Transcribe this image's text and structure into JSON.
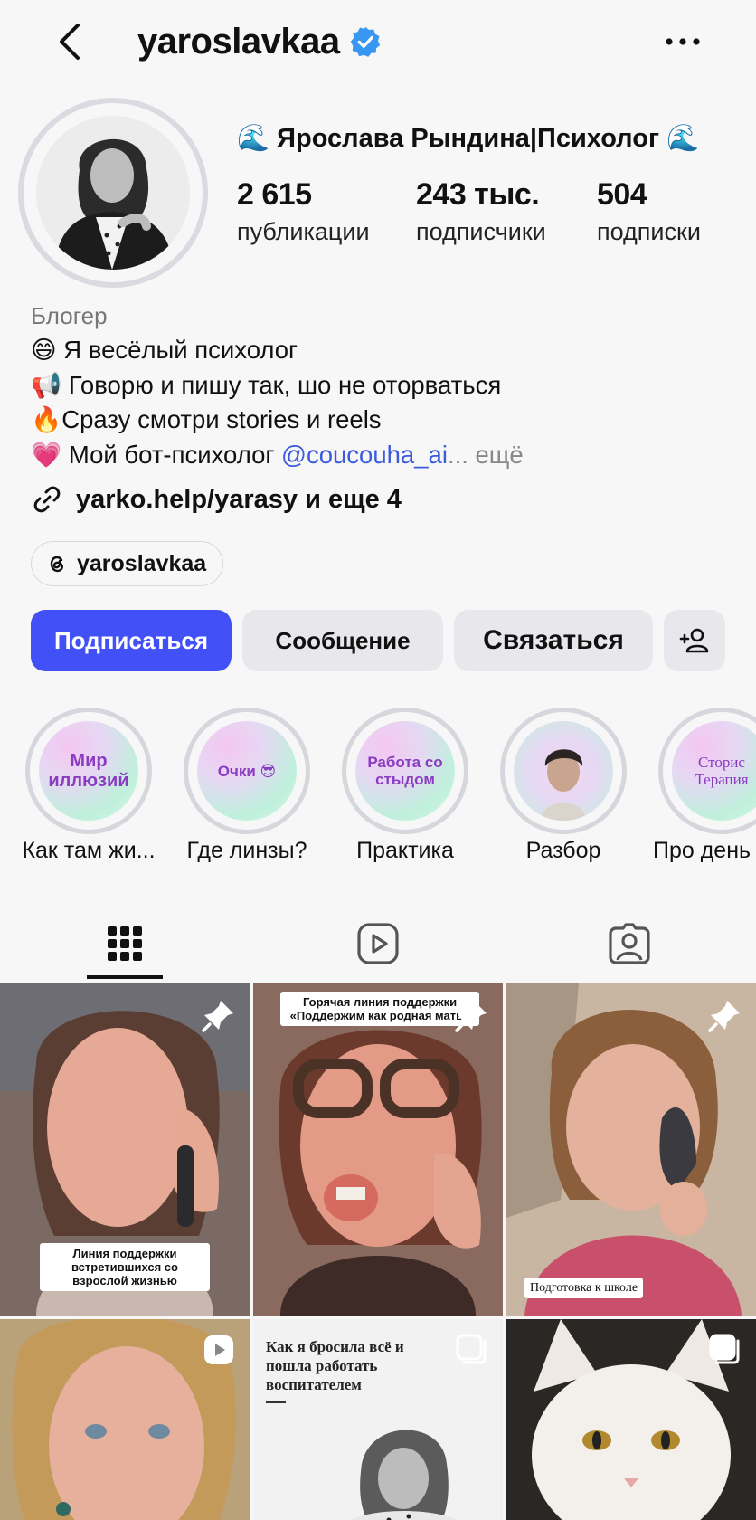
{
  "header": {
    "username": "yaroslavkaa"
  },
  "profile": {
    "full_name": "🌊 Ярослава Рындина|Психолог 🌊",
    "stats": [
      {
        "value": "2 615",
        "label": "публикации"
      },
      {
        "value": "243 тыс.",
        "label": "подписчики"
      },
      {
        "value": "504",
        "label": "подписки"
      }
    ],
    "category": "Блогер",
    "bio": [
      "😄 Я весёлый психолог",
      "📢 Говорю и пишу так, шо не оторваться",
      "🔥Сразу смотри stories и reels"
    ],
    "bio_last_prefix": "💗 Мой бот-психолог ",
    "bio_mention": "@coucouha_ai",
    "bio_more": "... ещё",
    "link": "yarko.help/yarasy и еще 4",
    "threads": "yaroslavkaa"
  },
  "actions": {
    "follow": "Подписаться",
    "message": "Сообщение",
    "contact": "Связаться"
  },
  "highlights": [
    {
      "cover_text": "Мир иллюзий",
      "label": "Как там жи..."
    },
    {
      "cover_text": "Очки 😎",
      "label": "Где линзы?"
    },
    {
      "cover_text": "Работа со стыдом",
      "label": "Практика"
    },
    {
      "cover_text": "",
      "label": "Разбор"
    },
    {
      "cover_text": "Сторис Терапия",
      "label": "Про день"
    }
  ],
  "posts": {
    "p1_caption": "Линия поддержки встретившихся со взрослой жизнью",
    "p2_caption": "Горячая линия поддержки «Поддержим как родная мать»",
    "p3_caption": "Подготовка к школе",
    "p5_caption": "Как я бросила всё и пошла работать воспитателем"
  },
  "colors": {
    "accent": "#4150f7",
    "mention": "#3b5bdb",
    "verified": "#3897f0"
  },
  "icons": {
    "back": "chevron-left-icon",
    "more": "ellipsis-icon",
    "verified": "verified-badge-icon",
    "link": "link-icon",
    "threads": "threads-icon",
    "add_person": "add-person-icon",
    "tab_grid": "grid-icon",
    "tab_reels": "reels-icon",
    "tab_tagged": "tagged-icon",
    "pin": "pin-icon",
    "clip": "reel-clip-icon",
    "carousel": "carousel-icon"
  }
}
